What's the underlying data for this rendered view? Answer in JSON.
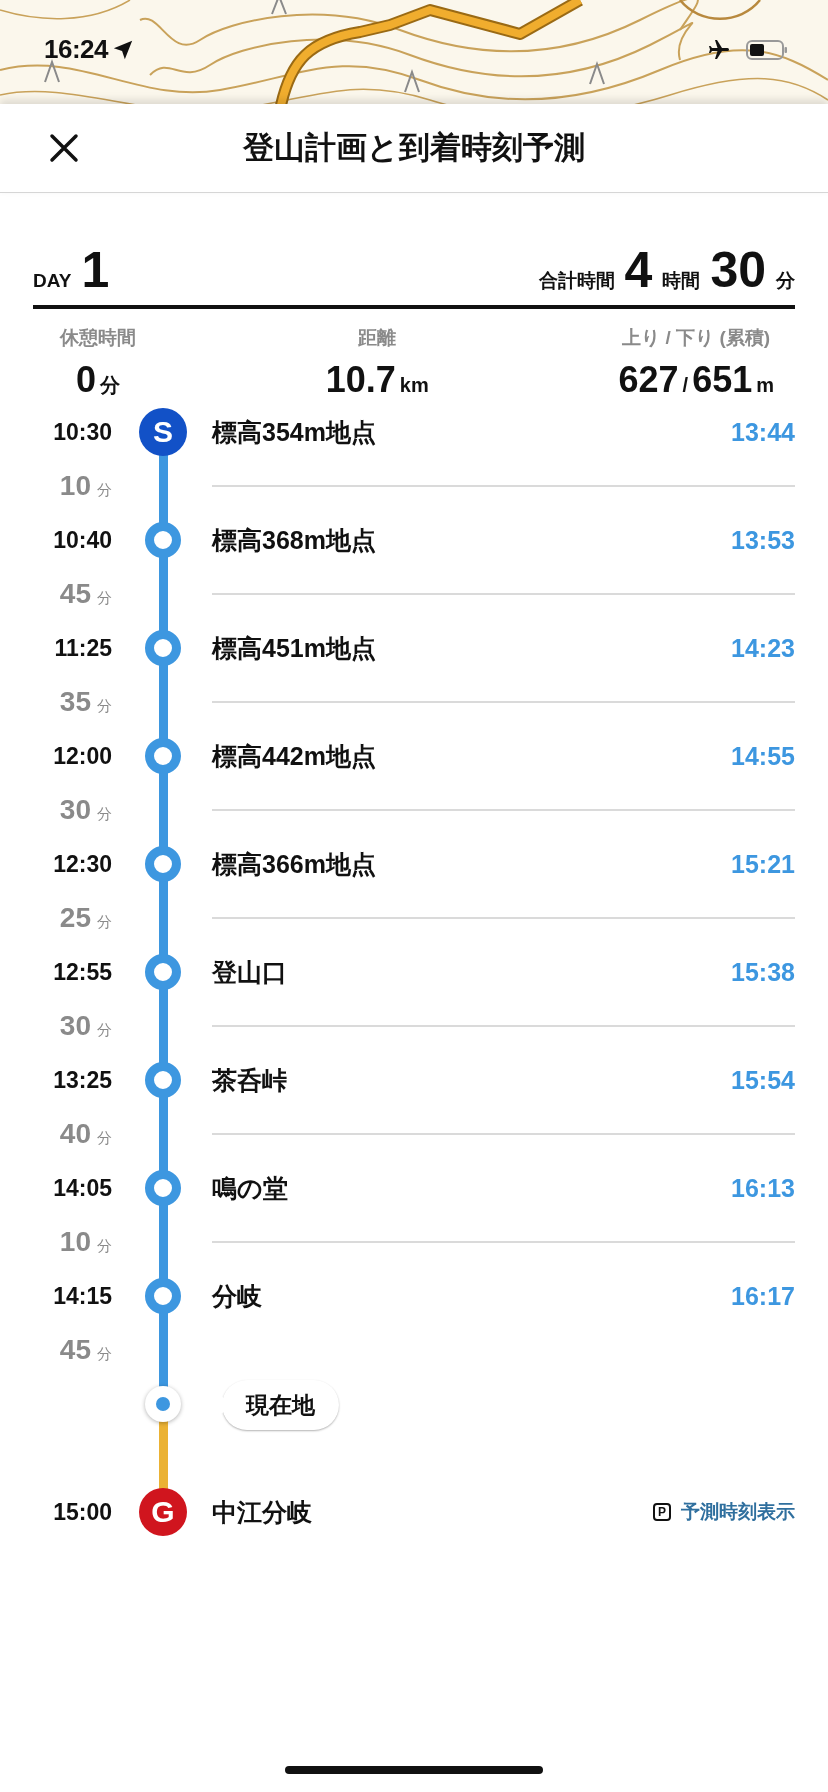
{
  "status_bar": {
    "time": "16:24"
  },
  "header": {
    "title": "登山計画と到着時刻予測"
  },
  "summary": {
    "day_label": "DAY",
    "day": "1",
    "total_label": "合計時間",
    "hours": "4",
    "hours_unit": "時間",
    "minutes": "30",
    "minutes_unit": "分"
  },
  "stats": [
    {
      "label": "休憩時間",
      "value": "0",
      "unit": "分"
    },
    {
      "label": "距離",
      "value": "10.7",
      "unit": "km"
    },
    {
      "label": "上り / 下り (累積)",
      "value": "627",
      "separator": "/",
      "value2": "651",
      "unit": "m"
    }
  ],
  "timeline": [
    {
      "kind": "point",
      "node": {
        "kind": "start",
        "label": "S"
      },
      "time": "10:30",
      "name": "標高354m地点",
      "arrival": "13:44"
    },
    {
      "kind": "leg",
      "duration": "10",
      "unit": "分"
    },
    {
      "kind": "point",
      "time": "10:40",
      "name": "標高368m地点",
      "arrival": "13:53"
    },
    {
      "kind": "leg",
      "duration": "45",
      "unit": "分"
    },
    {
      "kind": "point",
      "time": "11:25",
      "name": "標高451m地点",
      "arrival": "14:23"
    },
    {
      "kind": "leg",
      "duration": "35",
      "unit": "分"
    },
    {
      "kind": "point",
      "time": "12:00",
      "name": "標高442m地点",
      "arrival": "14:55"
    },
    {
      "kind": "leg",
      "duration": "30",
      "unit": "分"
    },
    {
      "kind": "point",
      "time": "12:30",
      "name": "標高366m地点",
      "arrival": "15:21"
    },
    {
      "kind": "leg",
      "duration": "25",
      "unit": "分"
    },
    {
      "kind": "point",
      "time": "12:55",
      "name": "登山口",
      "arrival": "15:38"
    },
    {
      "kind": "leg",
      "duration": "30",
      "unit": "分"
    },
    {
      "kind": "point",
      "time": "13:25",
      "name": "茶呑峠",
      "arrival": "15:54"
    },
    {
      "kind": "leg",
      "duration": "40",
      "unit": "分"
    },
    {
      "kind": "point",
      "time": "14:05",
      "name": "鳴の堂",
      "arrival": "16:13"
    },
    {
      "kind": "leg",
      "duration": "10",
      "unit": "分"
    },
    {
      "kind": "point",
      "time": "14:15",
      "name": "分岐",
      "arrival": "16:17"
    },
    {
      "kind": "leg",
      "duration": "45",
      "unit": "分"
    },
    {
      "kind": "current",
      "label": "現在地"
    },
    {
      "kind": "point",
      "node": {
        "kind": "goal",
        "label": "G"
      },
      "time": "15:00",
      "name": "中江分岐",
      "link_badge": "P",
      "link": "予測時刻表示"
    }
  ]
}
